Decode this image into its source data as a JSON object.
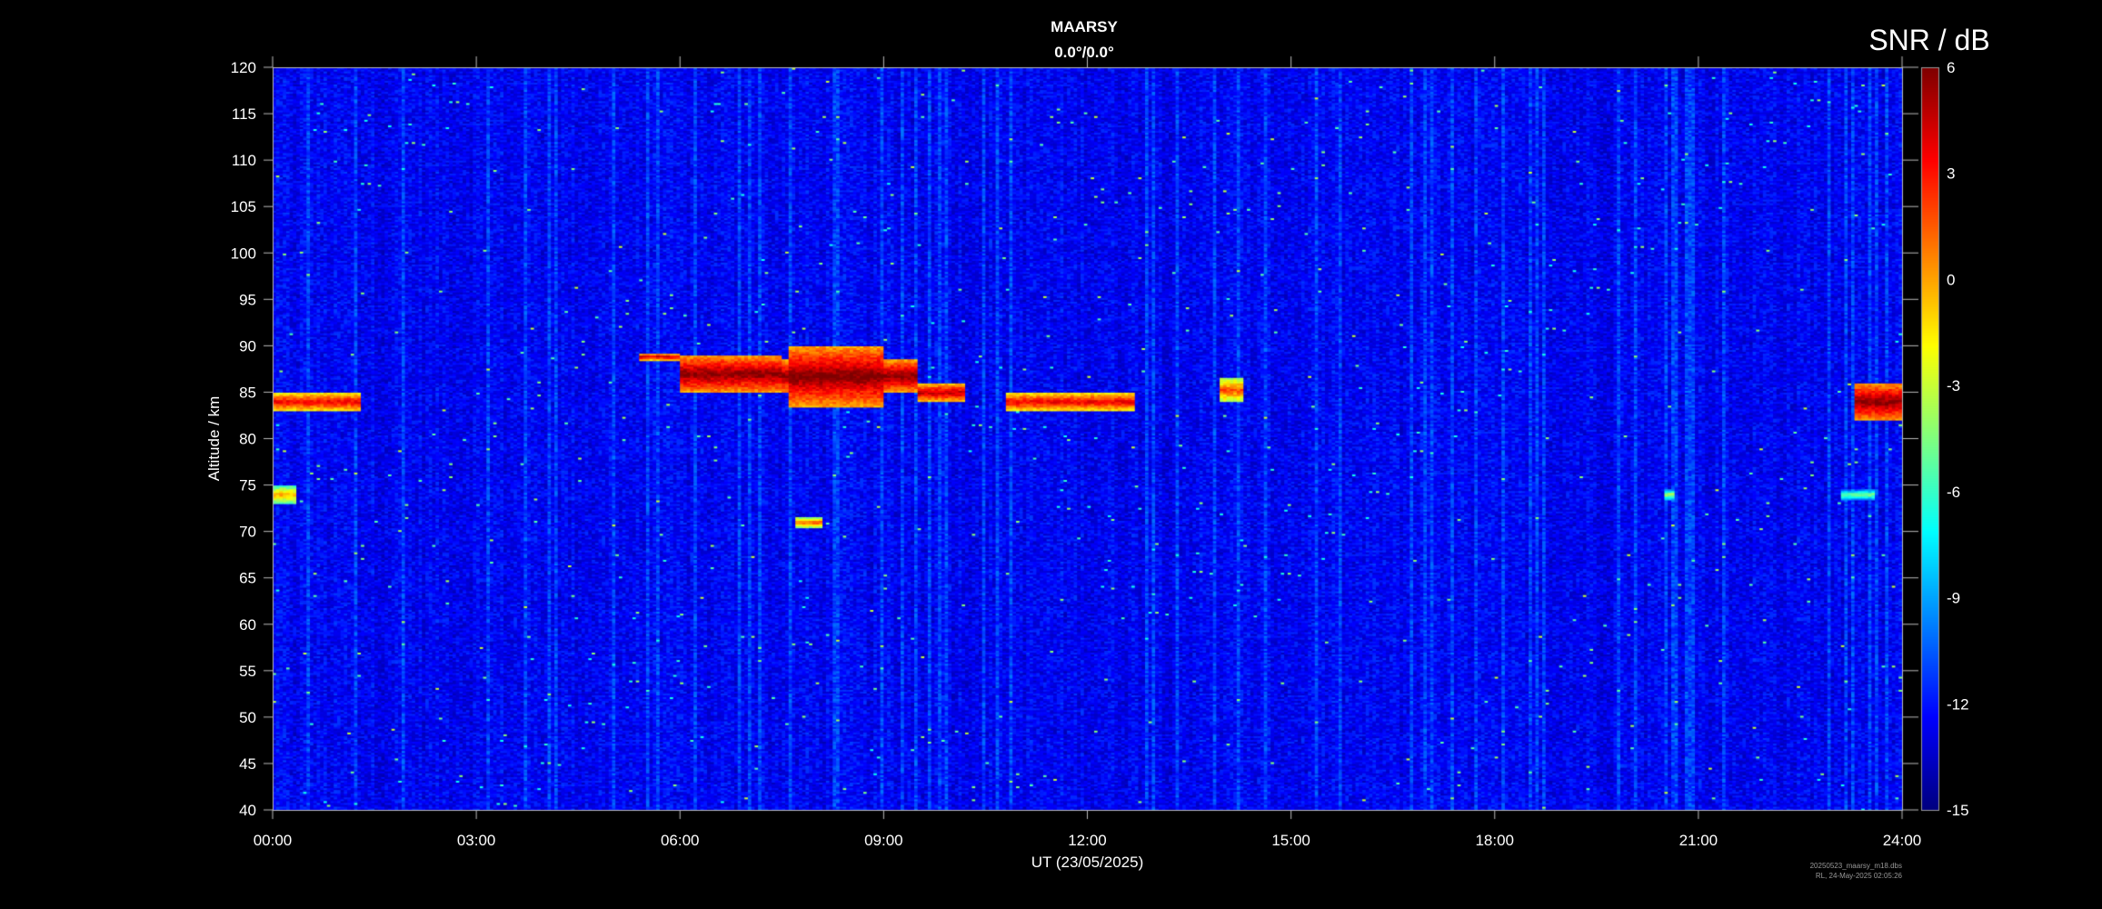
{
  "chart_data": {
    "type": "heatmap",
    "title": "MAARSY",
    "subtitle": "0.0°/0.0°",
    "xlabel": "UT (23/05/2025)",
    "ylabel": "Altitude / km",
    "x_ticks": [
      "00:00",
      "03:00",
      "06:00",
      "09:00",
      "12:00",
      "15:00",
      "18:00",
      "21:00",
      "24:00"
    ],
    "xlim_hours": [
      0,
      24
    ],
    "y_ticks": [
      40,
      45,
      50,
      55,
      60,
      65,
      70,
      75,
      80,
      85,
      90,
      95,
      100,
      105,
      110,
      115,
      120
    ],
    "ylim": [
      40,
      120
    ],
    "colorbar": {
      "label": "SNR / dB",
      "ticks": [
        6,
        3,
        0,
        -3,
        -6,
        -9,
        -12,
        -15
      ],
      "range": [
        -15,
        6
      ],
      "colormap": "jet"
    },
    "background_snr": -12.5,
    "echo_regions": [
      {
        "t_start": 0.0,
        "t_end": 1.3,
        "alt_low": 83,
        "alt_high": 85,
        "snr": 4
      },
      {
        "t_start": 0.0,
        "t_end": 0.35,
        "alt_low": 73,
        "alt_high": 75,
        "snr": 0
      },
      {
        "t_start": 5.4,
        "t_end": 6.0,
        "alt_low": 88.5,
        "alt_high": 89.2,
        "snr": 5
      },
      {
        "t_start": 6.0,
        "t_end": 7.5,
        "alt_low": 85,
        "alt_high": 89,
        "snr": 6
      },
      {
        "t_start": 7.5,
        "t_end": 9.5,
        "alt_low": 85,
        "alt_high": 88.5,
        "snr": 6
      },
      {
        "t_start": 7.6,
        "t_end": 9.0,
        "alt_low": 83.5,
        "alt_high": 90,
        "snr": 6
      },
      {
        "t_start": 9.5,
        "t_end": 10.2,
        "alt_low": 84,
        "alt_high": 86,
        "snr": 5
      },
      {
        "t_start": 10.8,
        "t_end": 12.7,
        "alt_low": 83,
        "alt_high": 85,
        "snr": 4
      },
      {
        "t_start": 13.95,
        "t_end": 14.3,
        "alt_low": 84,
        "alt_high": 86.5,
        "snr": 2
      },
      {
        "t_start": 23.3,
        "t_end": 24.0,
        "alt_low": 82,
        "alt_high": 86,
        "snr": 6
      },
      {
        "t_start": 7.7,
        "t_end": 8.1,
        "alt_low": 70.5,
        "alt_high": 71.5,
        "snr": 2
      },
      {
        "t_start": 20.5,
        "t_end": 20.65,
        "alt_low": 73.5,
        "alt_high": 74.5,
        "snr": -3
      },
      {
        "t_start": 23.1,
        "t_end": 23.6,
        "alt_low": 73.5,
        "alt_high": 74.5,
        "snr": -4
      }
    ],
    "footer_file": "20250523_maarsy_m18.dbs",
    "footer_created": "RL, 24-May-2025 02:05:26"
  }
}
